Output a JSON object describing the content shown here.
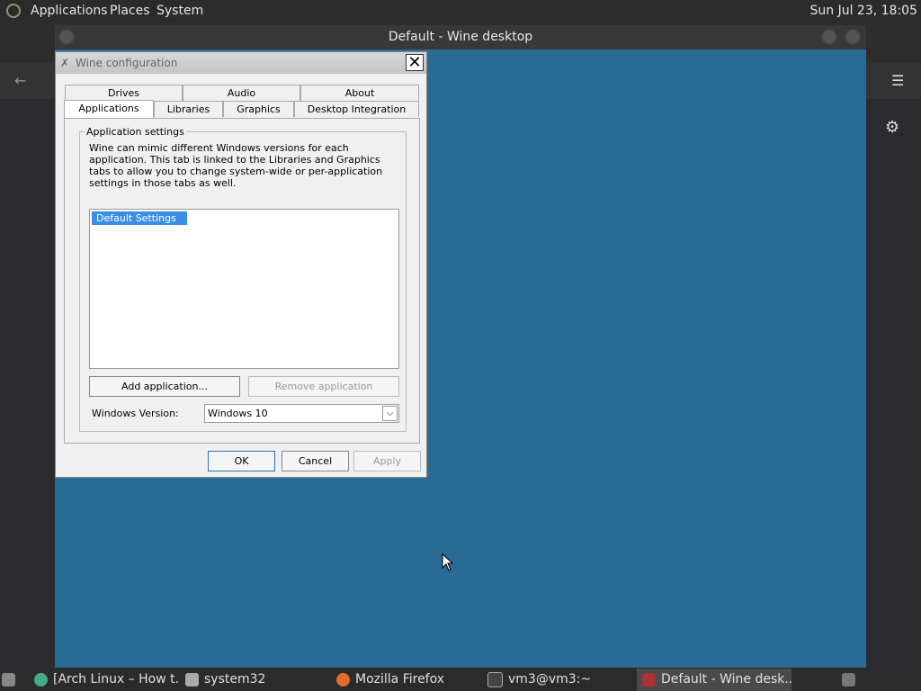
{
  "top_panel": {
    "menus": [
      "Applications",
      "Places",
      "System"
    ],
    "clock": "Sun Jul 23, 18:05"
  },
  "wine_desktop": {
    "title": "Default - Wine desktop"
  },
  "dialog": {
    "title": "Wine configuration",
    "tabs_row1": [
      "Drives",
      "Audio",
      "About"
    ],
    "tabs_row2": [
      "Applications",
      "Libraries",
      "Graphics",
      "Desktop Integration"
    ],
    "active_tab": "Applications",
    "group_title": "Application settings",
    "description": "Wine can mimic different Windows versions for each application. This tab is linked to the Libraries and Graphics tabs to allow you to change system-wide or per-application settings in those tabs as well.",
    "app_list": [
      "Default Settings"
    ],
    "add_button": "Add application...",
    "remove_button": "Remove application",
    "version_label": "Windows Version:",
    "version_value": "Windows 10",
    "ok": "OK",
    "cancel": "Cancel",
    "apply": "Apply"
  },
  "taskbar": {
    "items": [
      "[Arch Linux – How t...",
      "system32",
      "Mozilla Firefox",
      "vm3@vm3:~",
      "Default - Wine desk..."
    ]
  }
}
